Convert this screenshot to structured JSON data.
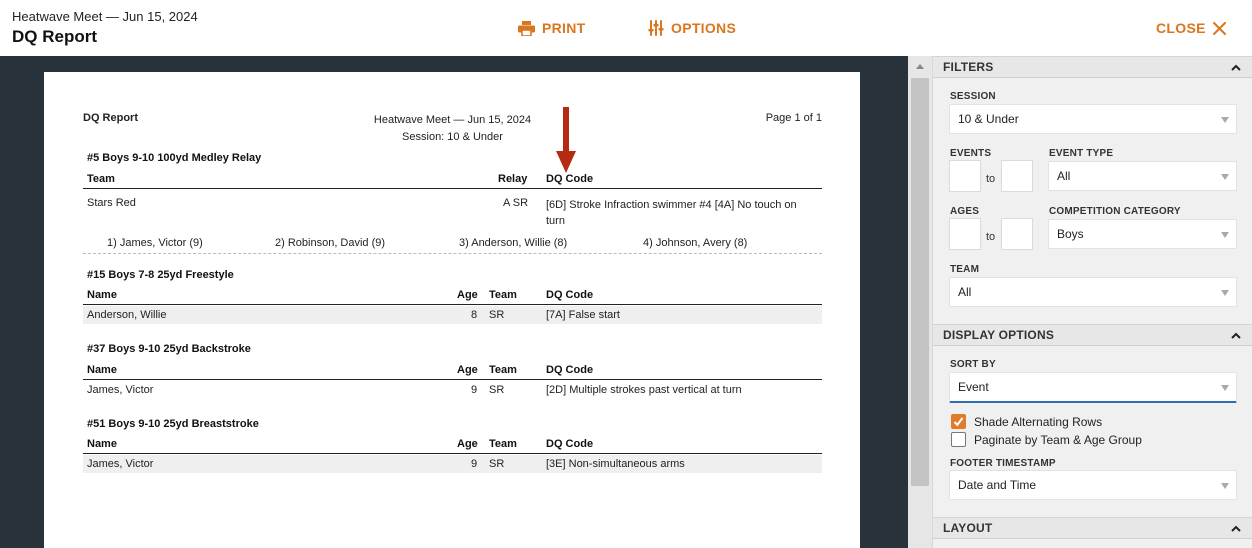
{
  "header": {
    "meet_title": "Heatwave Meet — Jun 15, 2024",
    "page_title": "DQ Report",
    "print_label": "PRINT",
    "options_label": "OPTIONS",
    "close_label": "CLOSE"
  },
  "report": {
    "left_title": "DQ Report",
    "center_line1": "Heatwave Meet — Jun 15, 2024",
    "center_line2": "Session: 10 & Under",
    "page_label": "Page 1 of 1",
    "relay_event": {
      "title": "#5 Boys 9-10 100yd Medley Relay",
      "headers": {
        "team": "Team",
        "relay": "Relay",
        "dq": "DQ Code"
      },
      "row": {
        "team": "Stars Red",
        "relay": "A SR",
        "dq": "[6D] Stroke Infraction swimmer #4 [4A] No touch on turn",
        "swimmers": [
          "1) James, Victor (9)",
          "2) Robinson, David (9)",
          "3) Anderson, Willie (8)",
          "4) Johnson, Avery (8)"
        ]
      }
    },
    "events": [
      {
        "title": "#15 Boys 7-8 25yd Freestyle",
        "headers": {
          "name": "Name",
          "age": "Age",
          "team": "Team",
          "dq": "DQ Code"
        },
        "row": {
          "name": "Anderson, Willie",
          "age": "8",
          "team": "SR",
          "dq": "[7A] False start"
        }
      },
      {
        "title": "#37 Boys 9-10 25yd Backstroke",
        "headers": {
          "name": "Name",
          "age": "Age",
          "team": "Team",
          "dq": "DQ Code"
        },
        "row": {
          "name": "James, Victor",
          "age": "9",
          "team": "SR",
          "dq": "[2D] Multiple strokes past vertical at turn"
        }
      },
      {
        "title": "#51 Boys 9-10 25yd Breaststroke",
        "headers": {
          "name": "Name",
          "age": "Age",
          "team": "Team",
          "dq": "DQ Code"
        },
        "row": {
          "name": "James, Victor",
          "age": "9",
          "team": "SR",
          "dq": "[3E] Non-simultaneous arms"
        }
      }
    ]
  },
  "filters": {
    "section_title": "FILTERS",
    "session_label": "SESSION",
    "session_value": "10 & Under",
    "events_label": "EVENTS",
    "events_to": "to",
    "event_type_label": "EVENT TYPE",
    "event_type_value": "All",
    "ages_label": "AGES",
    "ages_to": "to",
    "competition_label": "COMPETITION CATEGORY",
    "competition_value": "Boys",
    "team_label": "TEAM",
    "team_value": "All"
  },
  "display": {
    "section_title": "DISPLAY OPTIONS",
    "sort_label": "SORT BY",
    "sort_value": "Event",
    "shade_label": "Shade Alternating Rows",
    "shade_checked": true,
    "paginate_label": "Paginate by Team & Age Group",
    "paginate_checked": false,
    "footer_label": "FOOTER TIMESTAMP",
    "footer_value": "Date and Time"
  },
  "layout": {
    "section_title": "LAYOUT"
  },
  "colors": {
    "accent": "#d9761e",
    "checkbox": "#e07b2a",
    "arrow": "#b52a12",
    "backdrop": "#28323a"
  }
}
